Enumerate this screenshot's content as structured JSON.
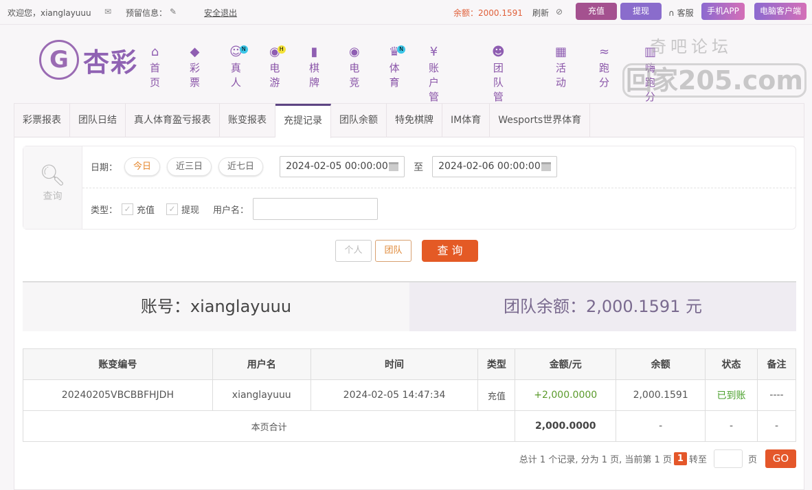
{
  "topbar": {
    "welcome": "欢迎您，xianglayuuu",
    "reserved_label": "预留信息：",
    "logout": "安全退出",
    "balance": "余额：2000.1591",
    "refresh": "刷新",
    "deposit": "充值",
    "withdraw": "提现",
    "service": "客服",
    "mobile_app": "手机APP",
    "pc_client": "电脑客户端",
    "brand_color": "#9a5aa6"
  },
  "logo": {
    "text": "杏彩"
  },
  "nav": [
    {
      "label": "首页",
      "icon": "home-icon"
    },
    {
      "label": "彩票",
      "icon": "ticket-icon"
    },
    {
      "label": "真人",
      "icon": "dealer-icon",
      "badge": "N"
    },
    {
      "label": "电游",
      "icon": "gamepad-icon",
      "badge": "H"
    },
    {
      "label": "棋牌",
      "icon": "cards-icon"
    },
    {
      "label": "电竞",
      "icon": "gamepad-icon"
    },
    {
      "label": "体育",
      "icon": "trophy-icon",
      "badge": "N"
    },
    {
      "label": "账户管理",
      "icon": "yen-icon"
    },
    {
      "label": "团队管理",
      "icon": "users-icon"
    },
    {
      "label": "活动",
      "icon": "gift-icon"
    },
    {
      "label": "跑分",
      "icon": "rhino-icon"
    },
    {
      "label": "嗨跑分",
      "icon": "chart-icon"
    }
  ],
  "watermark": {
    "line1": "奇吧论坛",
    "line2": "回家205.com"
  },
  "tabs": [
    "彩票报表",
    "团队日结",
    "真人体育盈亏报表",
    "账变报表",
    "充提记录",
    "团队余额",
    "特免棋牌",
    "IM体育",
    "Wesports世界体育"
  ],
  "active_tab": "充提记录",
  "filter": {
    "search_label": "查询",
    "date_label": "日期：",
    "quick": [
      "今日",
      "近三日",
      "近七日"
    ],
    "start": "2024-02-05 00:00:00",
    "to": "至",
    "end": "2024-02-06 00:00:00",
    "type_label": "类型：",
    "types": [
      "充值",
      "提现"
    ],
    "username_label": "用户名：",
    "username_value": ""
  },
  "actions": {
    "personal": "个人",
    "team": "团队",
    "query": "查 询"
  },
  "summary": {
    "account": "账号：xianglayuuu",
    "team_balance": "团队余额：2,000.1591 元"
  },
  "table": {
    "headers": [
      "账变编号",
      "用户名",
      "时间",
      "类型",
      "金额/元",
      "余额",
      "状态",
      "备注"
    ],
    "rows": [
      [
        "20240205VBCBBFHJDH",
        "xianglayuuu",
        "2024-02-05 14:47:34",
        "充值",
        "+2,000.0000",
        "2,000.1591",
        "已到账",
        "----"
      ]
    ],
    "total": {
      "label": "本页合计",
      "amount": "2,000.0000",
      "balance": "-",
      "status": "-",
      "note": "-"
    }
  },
  "pager": {
    "summary": "总计 1 个记录, 分为 1 页, 当前第 1 页",
    "current": "1",
    "goto": "转至",
    "page": "页",
    "go": "GO"
  }
}
